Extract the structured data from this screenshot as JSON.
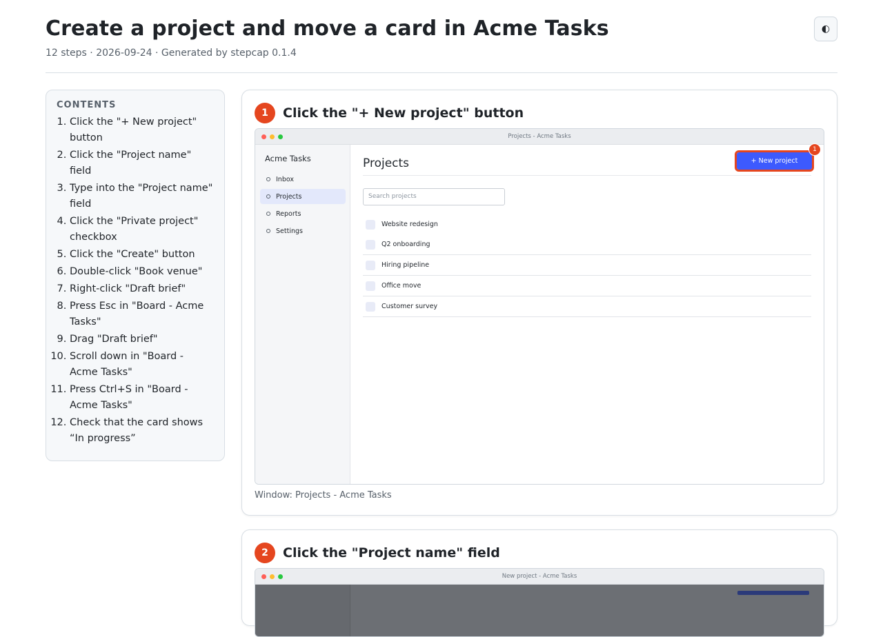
{
  "header": {
    "title": "Create a project and move a card in Acme Tasks",
    "meta": "12 steps · 2026-09-24 · Generated by stepcap 0.1.4",
    "theme_icon": "◐"
  },
  "toc": {
    "title": "CONTENTS",
    "items": [
      "Click the \"+ New project\" button",
      "Click the \"Project name\" field",
      "Type into the \"Project name\" field",
      "Click the \"Private project\" checkbox",
      "Click the \"Create\" button",
      "Double-click \"Book venue\"",
      "Right-click \"Draft brief\"",
      "Press Esc in \"Board - Acme Tasks\"",
      "Drag \"Draft brief\"",
      "Scroll down in \"Board - Acme Tasks\"",
      "Press Ctrl+S in \"Board - Acme Tasks\"",
      "Check that the card shows “In progress”"
    ]
  },
  "steps": [
    {
      "number": "1",
      "title": "Click the \"+ New project\" button",
      "caption": "Window: Projects - Acme Tasks",
      "screenshot": {
        "window_title": "Projects - Acme Tasks",
        "app_name": "Acme Tasks",
        "nav": [
          "Inbox",
          "Projects",
          "Reports",
          "Settings"
        ],
        "page_title": "Projects",
        "new_button": "+ New project",
        "highlight_badge": "1",
        "search_placeholder": "Search projects",
        "projects": [
          "Website redesign",
          "Q2 onboarding",
          "Hiring pipeline",
          "Office move",
          "Customer survey"
        ]
      }
    },
    {
      "number": "2",
      "title": "Click the \"Project name\" field",
      "screenshot": {
        "window_title": "New project - Acme Tasks"
      }
    }
  ],
  "colors": {
    "accent": "#e5461f",
    "primary_button": "#3d5afe",
    "dot_red": "#ff5f57",
    "dot_yellow": "#febc2e",
    "dot_green": "#28c840"
  }
}
